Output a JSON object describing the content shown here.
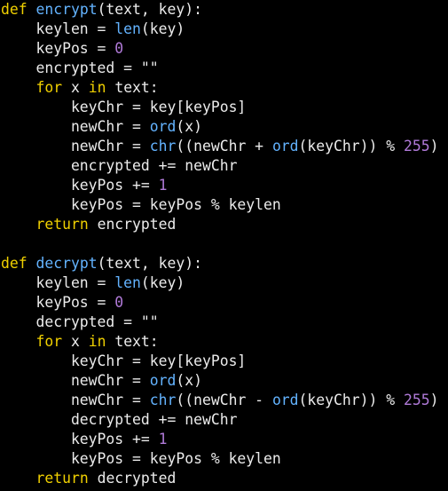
{
  "editor": {
    "colors": {
      "background": "#000000",
      "keyword": "#f0d000",
      "function_name": "#63b3ff",
      "builtin": "#63b3ff",
      "number": "#b07ad8",
      "text": "#ebebeb"
    },
    "lines": [
      [
        [
          "keyword",
          "def"
        ],
        [
          "text",
          " "
        ],
        [
          "funcname",
          "encrypt"
        ],
        [
          "text",
          "(text, key):"
        ]
      ],
      [
        [
          "text",
          "    keylen = "
        ],
        [
          "builtin",
          "len"
        ],
        [
          "text",
          "(key)"
        ]
      ],
      [
        [
          "text",
          "    keyPos = "
        ],
        [
          "number",
          "0"
        ]
      ],
      [
        [
          "text",
          "    encrypted = \"\""
        ]
      ],
      [
        [
          "text",
          "    "
        ],
        [
          "keyword",
          "for"
        ],
        [
          "text",
          " x "
        ],
        [
          "keyword",
          "in"
        ],
        [
          "text",
          " text:"
        ]
      ],
      [
        [
          "text",
          "        keyChr = key[keyPos]"
        ]
      ],
      [
        [
          "text",
          "        newChr = "
        ],
        [
          "builtin",
          "ord"
        ],
        [
          "text",
          "(x)"
        ]
      ],
      [
        [
          "text",
          "        newChr = "
        ],
        [
          "builtin",
          "chr"
        ],
        [
          "text",
          "((newChr + "
        ],
        [
          "builtin",
          "ord"
        ],
        [
          "text",
          "(keyChr)) % "
        ],
        [
          "number",
          "255"
        ],
        [
          "text",
          ")"
        ]
      ],
      [
        [
          "text",
          "        encrypted += newChr"
        ]
      ],
      [
        [
          "text",
          "        keyPos += "
        ],
        [
          "number",
          "1"
        ]
      ],
      [
        [
          "text",
          "        keyPos = keyPos % keylen"
        ]
      ],
      [
        [
          "text",
          "    "
        ],
        [
          "keyword",
          "return"
        ],
        [
          "text",
          " encrypted"
        ]
      ],
      [],
      [
        [
          "keyword",
          "def"
        ],
        [
          "text",
          " "
        ],
        [
          "funcname",
          "decrypt"
        ],
        [
          "text",
          "(text, key):"
        ]
      ],
      [
        [
          "text",
          "    keylen = "
        ],
        [
          "builtin",
          "len"
        ],
        [
          "text",
          "(key)"
        ]
      ],
      [
        [
          "text",
          "    keyPos = "
        ],
        [
          "number",
          "0"
        ]
      ],
      [
        [
          "text",
          "    decrypted = \"\""
        ]
      ],
      [
        [
          "text",
          "    "
        ],
        [
          "keyword",
          "for"
        ],
        [
          "text",
          " x "
        ],
        [
          "keyword",
          "in"
        ],
        [
          "text",
          " text:"
        ]
      ],
      [
        [
          "text",
          "        keyChr = key[keyPos]"
        ]
      ],
      [
        [
          "text",
          "        newChr = "
        ],
        [
          "builtin",
          "ord"
        ],
        [
          "text",
          "(x)"
        ]
      ],
      [
        [
          "text",
          "        newChr = "
        ],
        [
          "builtin",
          "chr"
        ],
        [
          "text",
          "((newChr - "
        ],
        [
          "builtin",
          "ord"
        ],
        [
          "text",
          "(keyChr)) % "
        ],
        [
          "number",
          "255"
        ],
        [
          "text",
          ")"
        ]
      ],
      [
        [
          "text",
          "        decrypted += newChr"
        ]
      ],
      [
        [
          "text",
          "        keyPos += "
        ],
        [
          "number",
          "1"
        ]
      ],
      [
        [
          "text",
          "        keyPos = keyPos % keylen"
        ]
      ],
      [
        [
          "text",
          "    "
        ],
        [
          "keyword",
          "return"
        ],
        [
          "text",
          " decrypted"
        ]
      ]
    ]
  }
}
